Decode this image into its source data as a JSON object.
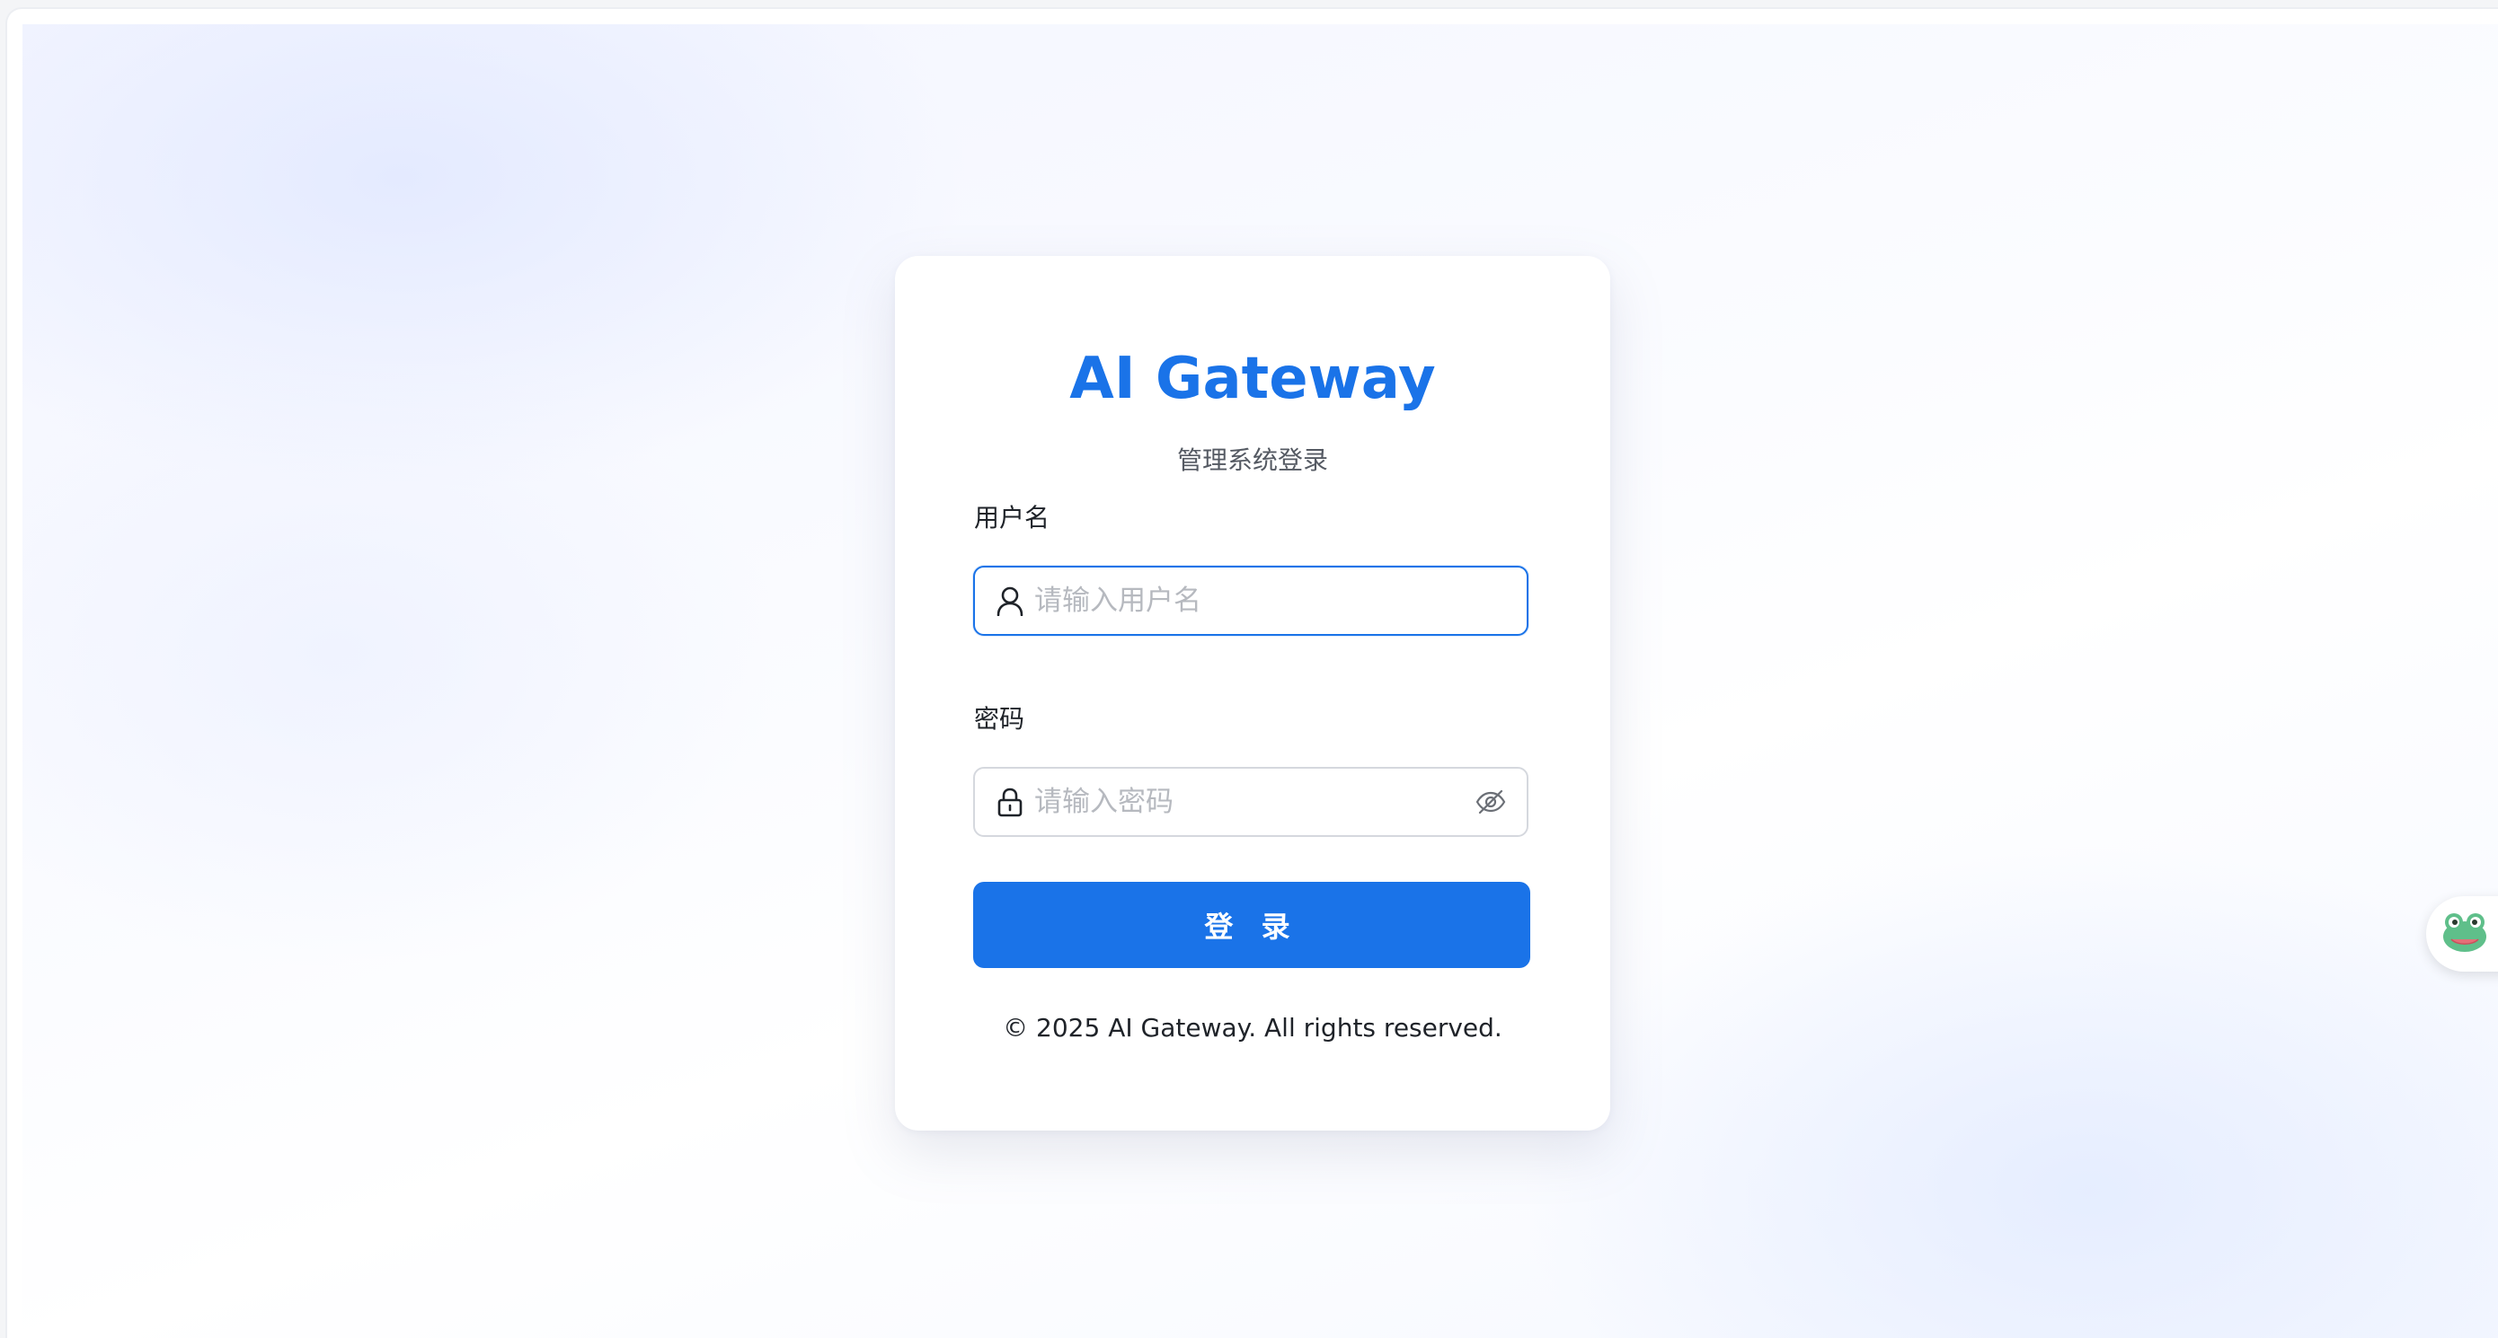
{
  "brand": {
    "title": "AI Gateway",
    "subtitle": "管理系统登录",
    "accent_color": "#1a73e8"
  },
  "form": {
    "username": {
      "label": "用户名",
      "placeholder": "请输入用户名",
      "value": "",
      "icon": "user-icon",
      "focused": true
    },
    "password": {
      "label": "密码",
      "placeholder": "请输入密码",
      "value": "",
      "icon": "lock-icon",
      "toggle_icon": "eye-off-icon"
    },
    "submit_label": "登 录"
  },
  "footer": {
    "copyright": "© 2025 AI Gateway. All rights reserved."
  },
  "floating_widget": {
    "icon": "frog-icon"
  }
}
